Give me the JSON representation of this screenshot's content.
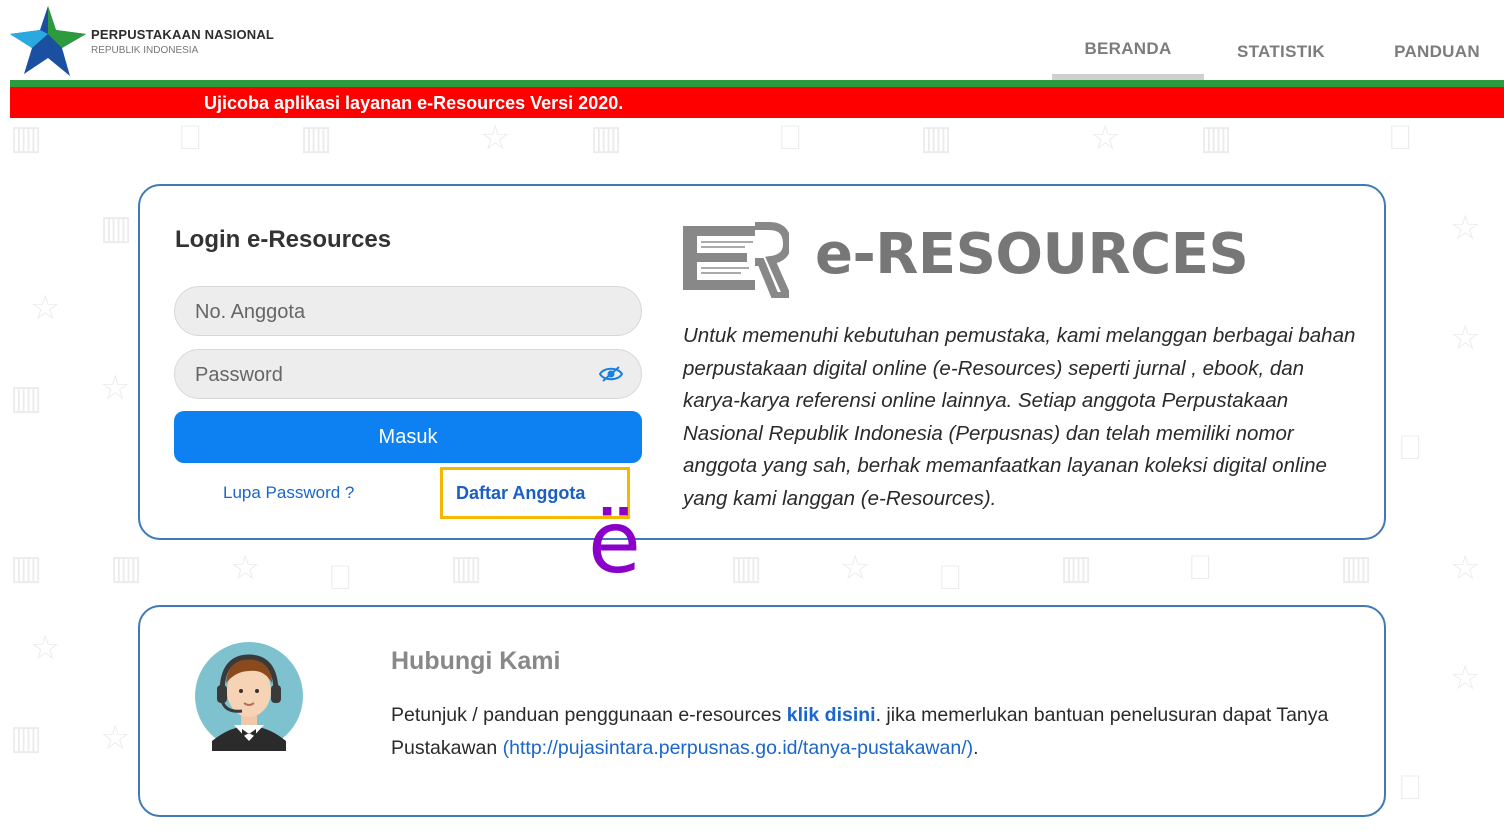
{
  "header": {
    "brand_name": "PERPUSTAKAAN NASIONAL",
    "brand_sub": "REPUBLIK INDONESIA",
    "nav": [
      "BERANDA",
      "STATISTIK",
      "PANDUAN"
    ],
    "active_nav": "BERANDA"
  },
  "banner": {
    "text": "Ujicoba aplikasi layanan e-Resources Versi 2020."
  },
  "login": {
    "title": "Login e-Resources",
    "member_placeholder": "No. Anggota",
    "password_placeholder": "Password",
    "submit_label": "Masuk",
    "forgot_label": "Lupa Password ?",
    "register_label": "Daftar Anggota"
  },
  "eresources": {
    "title": "e-RESOURCES",
    "description": "Untuk memenuhi kebutuhan pemustaka, kami melanggan berbagai bahan perpustakaan digital online (e-Resources) seperti jurnal , ebook, dan karya-karya referensi online lainnya. Setiap anggota Perpustakaan Nasional Republik Indonesia (Perpusnas) dan telah memiliki nomor anggota yang sah, berhak memanfaatkan layanan koleksi digital online yang kami langgan (e-Resources)."
  },
  "contact": {
    "title": "Hubungi Kami",
    "text_before": "Petunjuk / panduan penggunaan e-resources ",
    "link_label": "klik disini",
    "text_middle": ". jika memerlukan bantuan penelusuran dapat Tanya Pustakawan ",
    "url_label": "(http://pujasintara.perpusnas.go.id/tanya-pustakawan/)",
    "text_after": "."
  },
  "overlay": {
    "cursor_glyph": "ë"
  },
  "colors": {
    "green_bar": "#2e9a3e",
    "red_bar": "#ff0000",
    "card_border": "#3f7ab7",
    "primary_button": "#0d80f2",
    "highlight_box": "#f5b800"
  }
}
